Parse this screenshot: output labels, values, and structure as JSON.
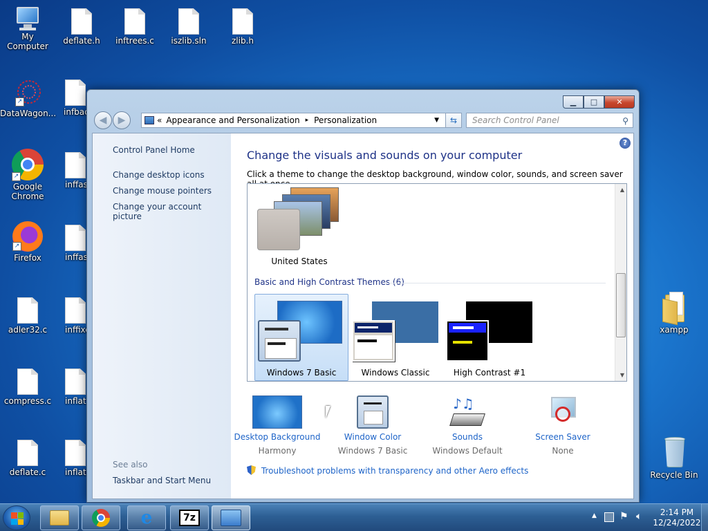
{
  "desktop": {
    "icons": [
      {
        "label": "My Computer"
      },
      {
        "label": "deflate.h"
      },
      {
        "label": "inftrees.c"
      },
      {
        "label": "iszlib.sln"
      },
      {
        "label": "zlib.h"
      },
      {
        "label": "DataWagon..."
      },
      {
        "label": "infbac"
      },
      {
        "label": "Google Chrome"
      },
      {
        "label": "inffas"
      },
      {
        "label": "Firefox"
      },
      {
        "label": "inffas"
      },
      {
        "label": "adler32.c"
      },
      {
        "label": "inffixe"
      },
      {
        "label": "compress.c"
      },
      {
        "label": "inflat"
      },
      {
        "label": "deflate.c"
      },
      {
        "label": "inflate"
      },
      {
        "label": "xampp"
      },
      {
        "label": "Recycle Bin"
      }
    ]
  },
  "window": {
    "caption_buttons": {
      "minimize": "▁",
      "maximize": "□",
      "close": "✕"
    },
    "address": {
      "chevrons": "«",
      "crumbs": [
        "Appearance and Personalization",
        "Personalization"
      ],
      "separator": "▸"
    },
    "search": {
      "placeholder": "Search Control Panel"
    },
    "left_nav": {
      "home": "Control Panel Home",
      "links": [
        "Change desktop icons",
        "Change mouse pointers",
        "Change your account picture"
      ],
      "see_also_title": "See also",
      "see_also_links": [
        "Taskbar and Start Menu"
      ]
    },
    "main": {
      "title": "Change the visuals and sounds on your computer",
      "subtitle": "Click a theme to change the desktop background, window color, sounds, and screen saver all at once.",
      "my_theme": "United States",
      "section": "Basic and High Contrast Themes (6)",
      "themes": [
        "Windows 7 Basic",
        "Windows Classic",
        "High Contrast #1"
      ],
      "selected_theme": "Windows 7 Basic",
      "settings": [
        {
          "title": "Desktop Background",
          "value": "Harmony"
        },
        {
          "title": "Window Color",
          "value": "Windows 7 Basic"
        },
        {
          "title": "Sounds",
          "value": "Windows Default"
        },
        {
          "title": "Screen Saver",
          "value": "None"
        }
      ],
      "troubleshoot": "Troubleshoot problems with transparency and other Aero effects",
      "help": "?"
    }
  },
  "taskbar": {
    "clock_time": "2:14 PM",
    "clock_date": "12/24/2022",
    "pinned": [
      "explorer",
      "chrome",
      "ie",
      "7zip",
      "control-panel"
    ],
    "app_7z": "7z"
  }
}
